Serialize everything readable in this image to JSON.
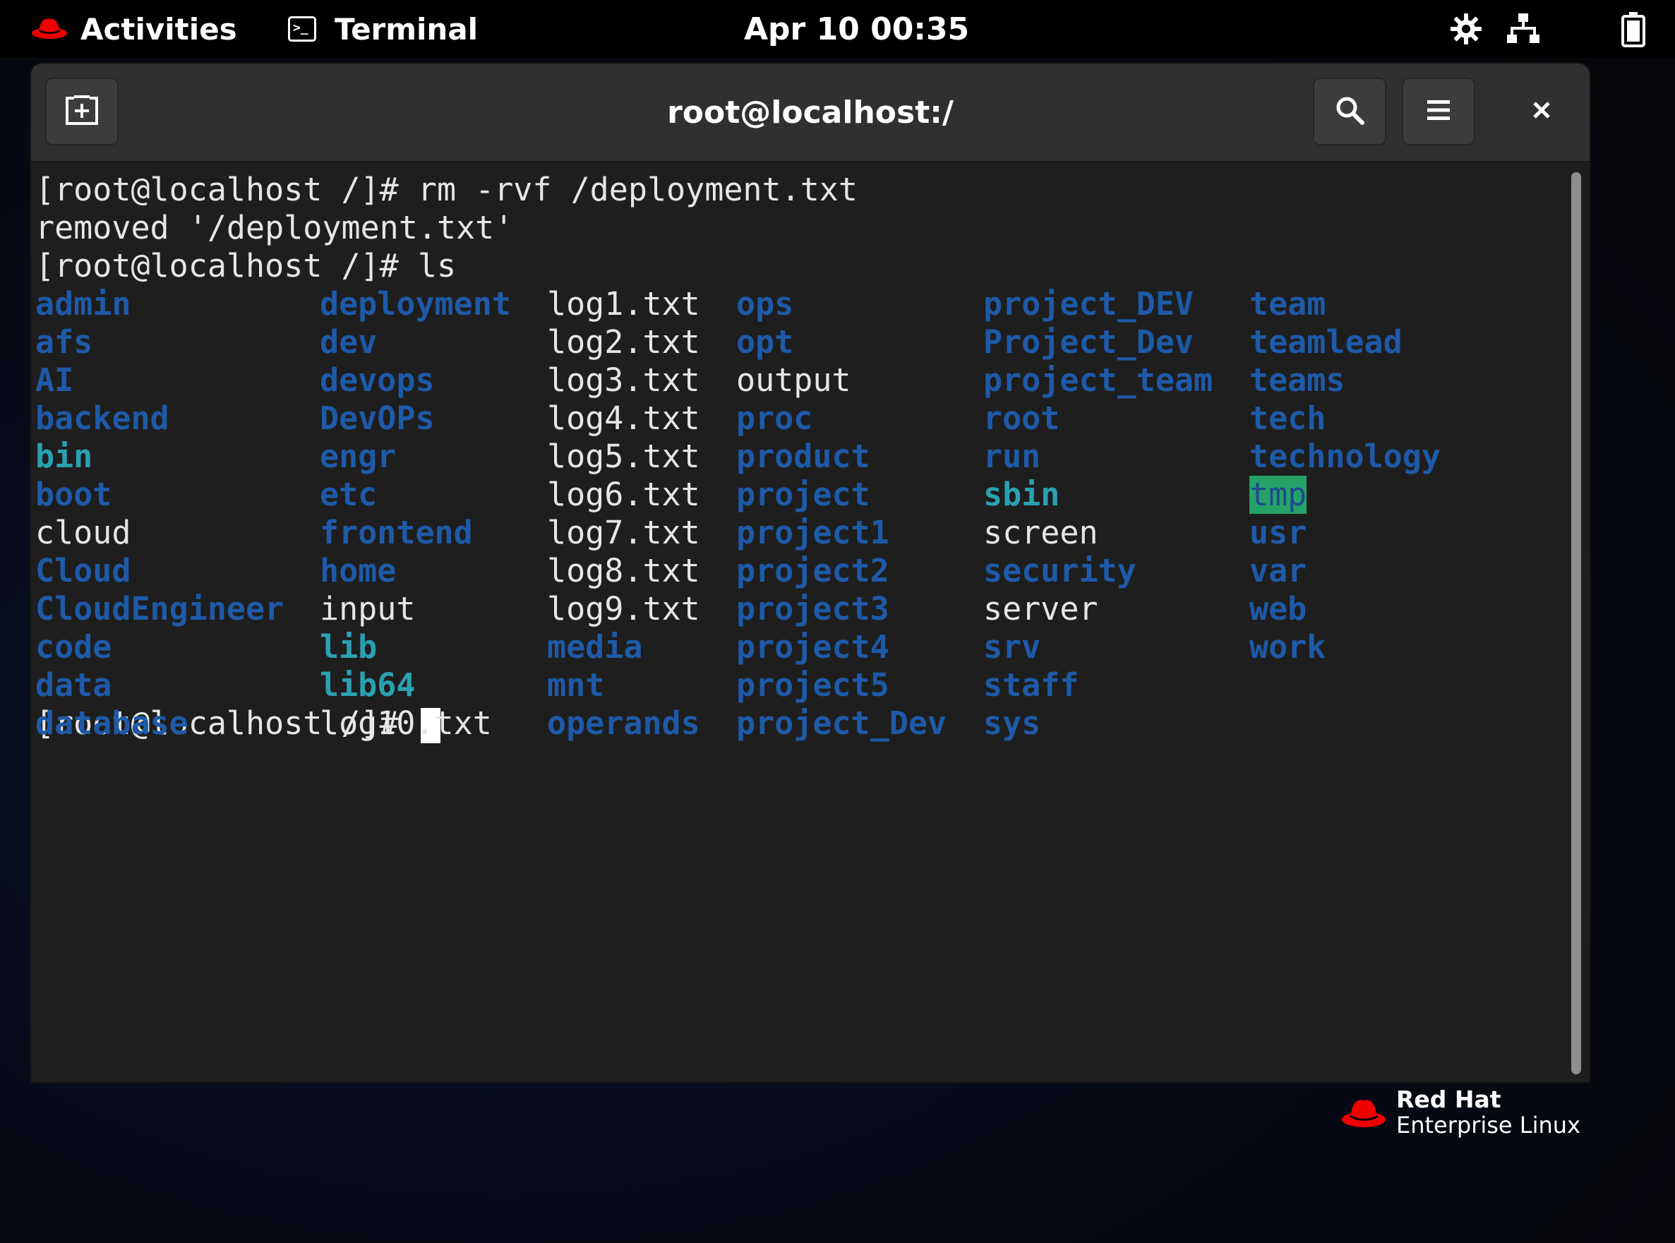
{
  "topbar": {
    "activities_label": "Activities",
    "app_label": "Terminal",
    "app_icon_text": ">_",
    "clock": "Apr 10  00:35"
  },
  "window": {
    "title": "root@localhost:/"
  },
  "terminal": {
    "lines": [
      "[root@localhost /]# rm -rvf /deployment.txt",
      "removed '/deployment.txt'",
      "[root@localhost /]# ls"
    ],
    "prompt": "[root@localhost /]# ",
    "ls_columns": [
      [
        {
          "name": "admin",
          "kind": "dir"
        },
        {
          "name": "afs",
          "kind": "dir"
        },
        {
          "name": "AI",
          "kind": "dir"
        },
        {
          "name": "backend",
          "kind": "dir"
        },
        {
          "name": "bin",
          "kind": "link"
        },
        {
          "name": "boot",
          "kind": "dir"
        },
        {
          "name": "cloud",
          "kind": "file"
        },
        {
          "name": "Cloud",
          "kind": "dir"
        },
        {
          "name": "CloudEngineer",
          "kind": "dir"
        },
        {
          "name": "code",
          "kind": "dir"
        },
        {
          "name": "data",
          "kind": "dir"
        },
        {
          "name": "database",
          "kind": "dir"
        }
      ],
      [
        {
          "name": "deployment",
          "kind": "dir"
        },
        {
          "name": "dev",
          "kind": "dir"
        },
        {
          "name": "devops",
          "kind": "dir"
        },
        {
          "name": "DevOPs",
          "kind": "dir"
        },
        {
          "name": "engr",
          "kind": "dir"
        },
        {
          "name": "etc",
          "kind": "dir"
        },
        {
          "name": "frontend",
          "kind": "dir"
        },
        {
          "name": "home",
          "kind": "dir"
        },
        {
          "name": "input",
          "kind": "file"
        },
        {
          "name": "lib",
          "kind": "link"
        },
        {
          "name": "lib64",
          "kind": "link"
        },
        {
          "name": "log10.txt",
          "kind": "file"
        }
      ],
      [
        {
          "name": "log1.txt",
          "kind": "file"
        },
        {
          "name": "log2.txt",
          "kind": "file"
        },
        {
          "name": "log3.txt",
          "kind": "file"
        },
        {
          "name": "log4.txt",
          "kind": "file"
        },
        {
          "name": "log5.txt",
          "kind": "file"
        },
        {
          "name": "log6.txt",
          "kind": "file"
        },
        {
          "name": "log7.txt",
          "kind": "file"
        },
        {
          "name": "log8.txt",
          "kind": "file"
        },
        {
          "name": "log9.txt",
          "kind": "file"
        },
        {
          "name": "media",
          "kind": "dir"
        },
        {
          "name": "mnt",
          "kind": "dir"
        },
        {
          "name": "operands",
          "kind": "dir"
        }
      ],
      [
        {
          "name": "ops",
          "kind": "dir"
        },
        {
          "name": "opt",
          "kind": "dir"
        },
        {
          "name": "output",
          "kind": "file"
        },
        {
          "name": "proc",
          "kind": "dir"
        },
        {
          "name": "product",
          "kind": "dir"
        },
        {
          "name": "project",
          "kind": "dir"
        },
        {
          "name": "project1",
          "kind": "dir"
        },
        {
          "name": "project2",
          "kind": "dir"
        },
        {
          "name": "project3",
          "kind": "dir"
        },
        {
          "name": "project4",
          "kind": "dir"
        },
        {
          "name": "project5",
          "kind": "dir"
        },
        {
          "name": "project_Dev",
          "kind": "dir"
        }
      ],
      [
        {
          "name": "project_DEV",
          "kind": "dir"
        },
        {
          "name": "Project_Dev",
          "kind": "dir"
        },
        {
          "name": "project_team",
          "kind": "dir"
        },
        {
          "name": "root",
          "kind": "dir"
        },
        {
          "name": "run",
          "kind": "dir"
        },
        {
          "name": "sbin",
          "kind": "link"
        },
        {
          "name": "screen",
          "kind": "file"
        },
        {
          "name": "security",
          "kind": "dir"
        },
        {
          "name": "server",
          "kind": "file"
        },
        {
          "name": "srv",
          "kind": "dir"
        },
        {
          "name": "staff",
          "kind": "dir"
        },
        {
          "name": "sys",
          "kind": "dir"
        }
      ],
      [
        {
          "name": "team",
          "kind": "dir"
        },
        {
          "name": "teamlead",
          "kind": "dir"
        },
        {
          "name": "teams",
          "kind": "dir"
        },
        {
          "name": "tech",
          "kind": "dir"
        },
        {
          "name": "technology",
          "kind": "dir"
        },
        {
          "name": "tmp",
          "kind": "sticky"
        },
        {
          "name": "usr",
          "kind": "dir"
        },
        {
          "name": "var",
          "kind": "dir"
        },
        {
          "name": "web",
          "kind": "dir"
        },
        {
          "name": "work",
          "kind": "dir"
        }
      ]
    ]
  },
  "colors": {
    "dir": "#1e5aa8",
    "link": "#2aa1b3",
    "file": "#e6e6e6",
    "sticky_bg": "#26a269",
    "redhat": "#ee0000"
  },
  "icons": {
    "activities": "redhat-hat-icon",
    "new_tab": "new-tab-icon",
    "search": "search-icon",
    "menu": "hamburger-menu-icon",
    "close": "close-icon",
    "settings": "gear-icon",
    "network": "network-icon",
    "battery": "battery-icon"
  },
  "logo": {
    "line1": "Red Hat",
    "line2": "Enterprise Linux"
  }
}
